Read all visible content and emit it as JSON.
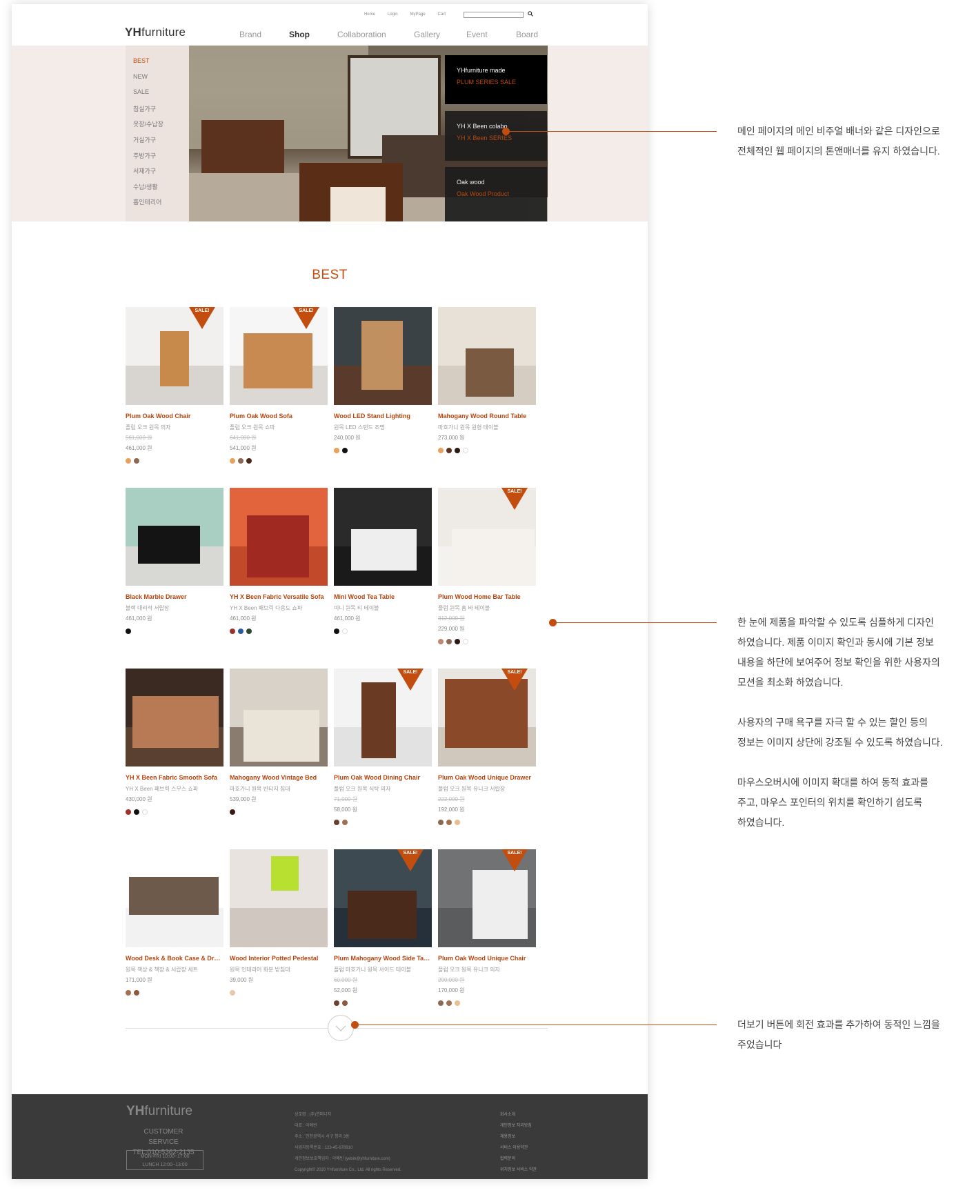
{
  "header": {
    "util_links": [
      "Home",
      "Login",
      "MyPage",
      "Cart"
    ],
    "search_placeholder": "",
    "logo_bold": "YH",
    "logo_rest": "furniture",
    "nav": [
      "Brand",
      "Shop",
      "Collaboration",
      "Gallery",
      "Event",
      "Board"
    ],
    "nav_active": "Shop"
  },
  "side_menu": [
    "BEST",
    "NEW",
    "SALE",
    "침실가구",
    "옷장/수납장",
    "거실가구",
    "주방가구",
    "서재가구",
    "수납/생활",
    "홈인테리어"
  ],
  "hero_boxes": [
    {
      "title": "YHfurniture made",
      "sub": "PLUM SERIES SALE"
    },
    {
      "title": "YH X Been colabo",
      "sub": "YH X Been SERIES"
    },
    {
      "title": "Oak wood",
      "sub": "Oak Wood Product"
    }
  ],
  "best_title": "BEST",
  "sale_label": "SALE!",
  "products": [
    {
      "name": "Plum Oak Wood Chair",
      "kr": "플럼 오크 원목 의자",
      "old": "561,000 원",
      "price": "461,000 원",
      "sale": true,
      "colors": [
        "#e8a15c",
        "#8a6a55"
      ]
    },
    {
      "name": "Plum Oak Wood Sofa",
      "kr": "플럼 오크 원목 쇼파",
      "old": "641,000 원",
      "price": "541,000 원",
      "sale": true,
      "colors": [
        "#e8a15c",
        "#8a6a55",
        "#4a2a1a"
      ]
    },
    {
      "name": "Wood LED Stand Lighting",
      "kr": "원목 LED 스탠드 조명",
      "old": "",
      "price": "240,000 원",
      "sale": false,
      "colors": [
        "#e8a15c",
        "#111111"
      ]
    },
    {
      "name": "Mahogany Wood Round Table",
      "kr": "마호가니 원목 원형 테이블",
      "old": "",
      "price": "273,000 원",
      "sale": false,
      "colors": [
        "#e8a15c",
        "#5a3020",
        "#2a1a12",
        "#ffffff"
      ]
    },
    {
      "name": "Black Marble Drawer",
      "kr": "블랙 대리석 서랍장",
      "old": "",
      "price": "461,000 원",
      "sale": false,
      "colors": [
        "#111111"
      ]
    },
    {
      "name": "YH X Been Fabric Versatile Sofa",
      "kr": "YH X Been 패브릭 다용도 쇼파",
      "old": "",
      "price": "461,000 원",
      "sale": false,
      "colors": [
        "#a0302a",
        "#2c5aa0",
        "#2c4a30"
      ]
    },
    {
      "name": "Mini Wood Tea Table",
      "kr": "미니 원목 티 테이블",
      "old": "",
      "price": "461,000 원",
      "sale": false,
      "colors": [
        "#111111",
        "#ffffff"
      ]
    },
    {
      "name": "Plum Wood Home Bar Table",
      "kr": "플럼 원목 홈 바 테이블",
      "old": "312,000 원",
      "price": "229,000 원",
      "sale": true,
      "colors": [
        "#c08870",
        "#8a6a55",
        "#2a1a12",
        "#ffffff"
      ]
    },
    {
      "name": "YH X Been Fabric Smooth Sofa",
      "kr": "YH X Been 패브릭 스무스 쇼파",
      "old": "",
      "price": "430,000 원",
      "sale": false,
      "colors": [
        "#a0302a",
        "#111111",
        "#ffffff"
      ]
    },
    {
      "name": "Mahogany Wood Vintage Bed",
      "kr": "마호가니 원목 빈티지 침대",
      "old": "",
      "price": "539,000 원",
      "sale": false,
      "colors": [
        "#3a1a12"
      ]
    },
    {
      "name": "Plum Oak Wood Dining Chair",
      "kr": "플럼 오크 원목 식탁 의자",
      "old": "71,000 원",
      "price": "58,000 원",
      "sale": true,
      "colors": [
        "#6a4030",
        "#a07050"
      ]
    },
    {
      "name": "Plum Oak Wood Unique Drawer",
      "kr": "플럼 오크 원목 유니크 서랍장",
      "old": "222,000 원",
      "price": "192,000 원",
      "sale": true,
      "colors": [
        "#8a6a55",
        "#a07050",
        "#e8c090"
      ]
    },
    {
      "name": "Wood Desk & Book Case & Drawer",
      "kr": "원목 책상 & 책장 & 서랍장 세트",
      "old": "",
      "price": "171,000 원",
      "sale": false,
      "colors": [
        "#a07050",
        "#8a5a40"
      ]
    },
    {
      "name": "Wood Interior Potted Pedestal",
      "kr": "원목 인테리어 화분 받침대",
      "old": "",
      "price": "39,000 원",
      "sale": false,
      "colors": [
        "#e8c8a8"
      ]
    },
    {
      "name": "Plum Mahogany Wood Side Table",
      "kr": "플럼 마호가니 원목 사이드 테이블",
      "old": "60,000 원",
      "price": "52,000 원",
      "sale": true,
      "colors": [
        "#6a4030",
        "#8a5a40"
      ]
    },
    {
      "name": "Plum Oak Wood Unique Chair",
      "kr": "플럼 오크 원목 유니크 의자",
      "old": "200,000 원",
      "price": "170,000 원",
      "sale": true,
      "colors": [
        "#8a6a55",
        "#a07050",
        "#e8c090"
      ]
    }
  ],
  "footer": {
    "logo_bold": "YH",
    "logo_rest": "furniture",
    "cs": "CUSTOMER SERVICE",
    "tel": "TEL:010-5362-2135",
    "hours1": "MON-FRI   10:00~17:00",
    "hours2": "LUNCH   12:00~13:00",
    "info": [
      "상호명 : (주)연퍼니처",
      "대표 : 이예빈",
      "주소 : 인천광역시 서구 청라 3동",
      "사업자등록번호 : 123-45-678910",
      "개인정보보호책임자 : 이예빈 (yebin@yhfurniture.com)",
      "Copyright© 2020 YHfurniture Co., Ltd. All rights Reserved."
    ],
    "links": [
      "회사소개",
      "개인정보 처리방침",
      "채용정보",
      "서비스 이용약관",
      "협력문의",
      "위치정보 서비스 약관"
    ]
  },
  "annotations": [
    "메인 페이지의 메인 비주얼 배너와 같은 디자인으로\n전체적인 웹 페이지의 톤앤매너를 유지 하였습니다.",
    "한 눈에 제품을 파악할 수 있도록 심플하게 디자인\n하였습니다.  제품 이미지 확인과 동시에 기본 정보\n내용을 하단에 보여주어 정보 확인을 위한 사용자의\n모션을 최소화 하였습니다.\n\n사용자의 구매 욕구를 자극 할 수 있는 할인 등의\n정보는 이미지 상단에 강조될 수 있도록 하였습니다.\n\n마우스오버시에 이미지 확대를 하여 동적 효과를\n주고, 마우스 포인터의 위치를 확인하기 쉽도록\n하였습니다.",
    "더보기 버튼에 회전 효과를 추가하여 동적인 느낌을\n주었습니다"
  ],
  "colors": {
    "accent": "#c24d0e",
    "footer_bg": "#3a3a3a"
  }
}
